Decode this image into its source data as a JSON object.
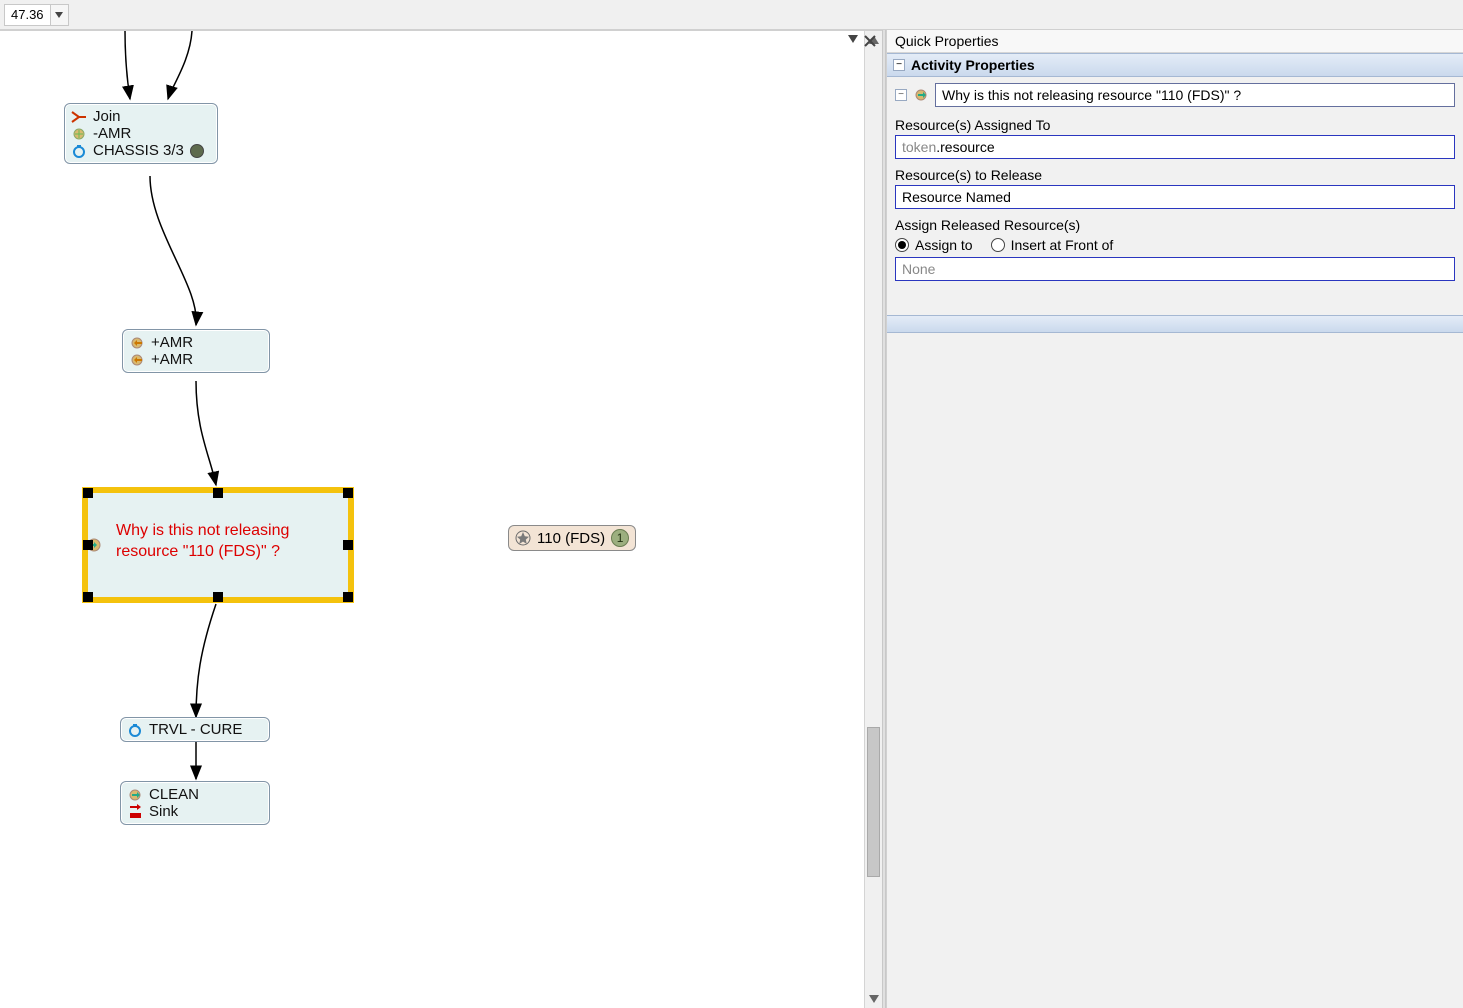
{
  "toolbar": {
    "zoom_value": "47.36"
  },
  "side": {
    "quick_properties_title": "Quick Properties",
    "section_title": "Activity Properties",
    "name_value": "Why is this not releasing resource \"110 (FDS)\" ?",
    "label_assigned_to": "Resource(s) Assigned To",
    "value_assigned_to_prefix": "token",
    "value_assigned_to_rest": ".resource",
    "label_to_release": "Resource(s) to Release",
    "value_to_release": "Resource Named",
    "label_assign_released": "Assign Released Resource(s)",
    "radio_assign_to": "Assign to",
    "radio_insert_front": "Insert at Front of",
    "value_assign_target": "None"
  },
  "diagram": {
    "join_node": {
      "line1": "Join",
      "line2": "-AMR",
      "line3": "CHASSIS 3/3"
    },
    "amr_node": {
      "line1": "+AMR",
      "line2": "+AMR"
    },
    "selected_text": "Why is this not releasing resource \"110 (FDS)\" ?",
    "resource_pill": {
      "label": "110 (FDS)",
      "count": "1"
    },
    "trvl_node": "TRVL - CURE",
    "clean_node": {
      "line1": "CLEAN",
      "line2": "Sink"
    }
  }
}
